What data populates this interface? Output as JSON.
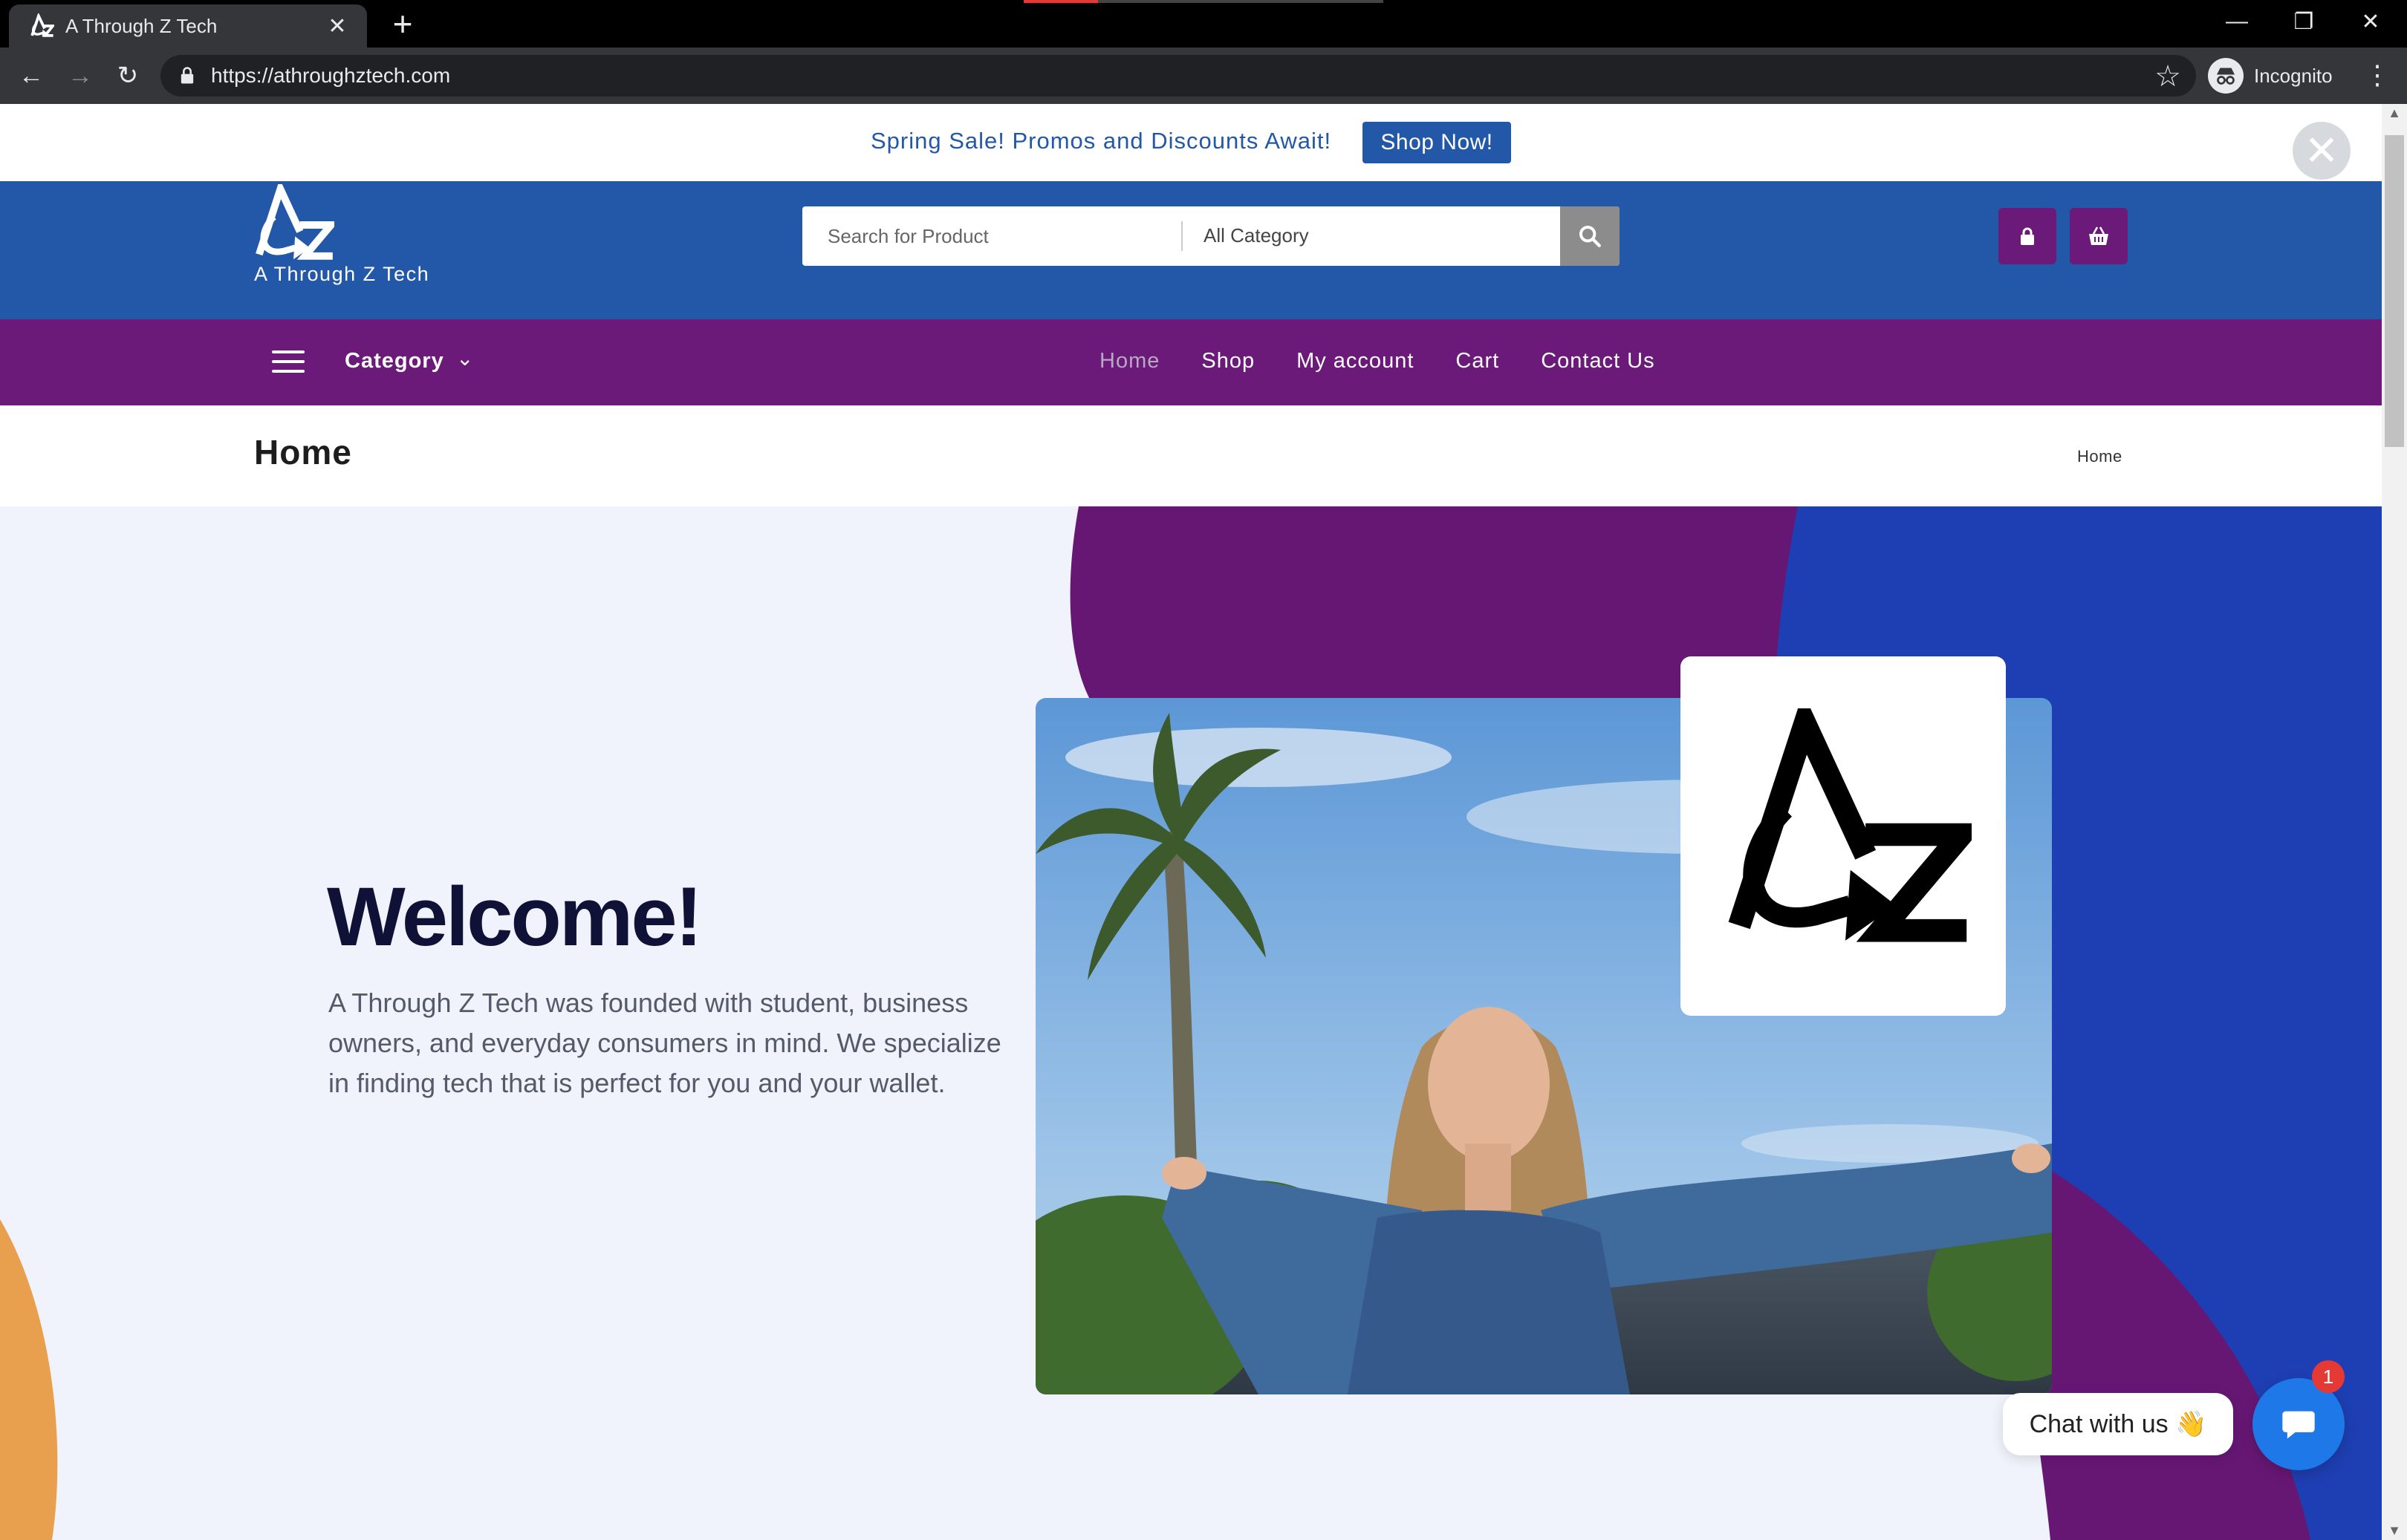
{
  "browser": {
    "tab_title": "A Through Z Tech",
    "tab_close": "✕",
    "new_tab": "+",
    "url": "https://athroughztech.com",
    "profile_label": "Incognito",
    "window_controls": {
      "minimize": "—",
      "restore": "❐",
      "close": "✕"
    },
    "nav": {
      "back": "←",
      "forward": "→",
      "reload": "↻"
    },
    "star": "☆",
    "menu": "⋮"
  },
  "announcement": {
    "text": "Spring Sale! Promos and Discounts Await!",
    "button_label": "Shop Now!",
    "close_glyph": "✕"
  },
  "header": {
    "brand_name": "A Through Z Tech",
    "search_placeholder": "Search for Product",
    "category_select": "All Category",
    "colors": {
      "header_bg": "#2357a8",
      "nav_bg": "#6b1a7a",
      "button_bg": "#6b1a7a"
    }
  },
  "navbar": {
    "category_label": "Category",
    "links": [
      "Home",
      "Shop",
      "My account",
      "Cart",
      "Contact Us"
    ],
    "active_link": "Home"
  },
  "page_header": {
    "title": "Home",
    "breadcrumb": "Home"
  },
  "hero": {
    "heading": "Welcome!",
    "body": "A Through Z Tech was founded with student, business owners, and everyday consumers in mind. We specialize in finding tech that is perfect for you and your wallet.",
    "colors": {
      "purple": "#661774",
      "blue": "#1e3fb3",
      "orange": "#e8a04e"
    }
  },
  "chat": {
    "label": "Chat with us 👋",
    "badge_count": "1"
  },
  "icons": [
    "az-logo-icon",
    "lock-icon",
    "star-icon",
    "incognito-icon",
    "search-icon",
    "padlock-icon",
    "basket-icon",
    "hamburger-icon",
    "chevron-down-icon",
    "close-icon",
    "chat-icon"
  ]
}
